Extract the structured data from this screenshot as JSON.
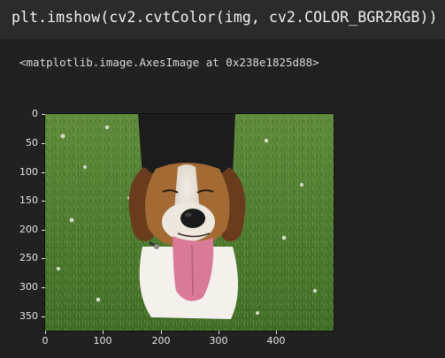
{
  "cell": {
    "code": "plt.imshow(cv2.cvtColor(img, cv2.COLOR_BGR2RGB))"
  },
  "output": {
    "repr": "<matplotlib.image.AxesImage at 0x238e1825d88>"
  },
  "image_axes": {
    "yticks": [
      "0",
      "50",
      "100",
      "150",
      "200",
      "250",
      "300",
      "350"
    ],
    "xticks": [
      "0",
      "100",
      "200",
      "300",
      "400"
    ],
    "image_subject": "dog-photo"
  }
}
